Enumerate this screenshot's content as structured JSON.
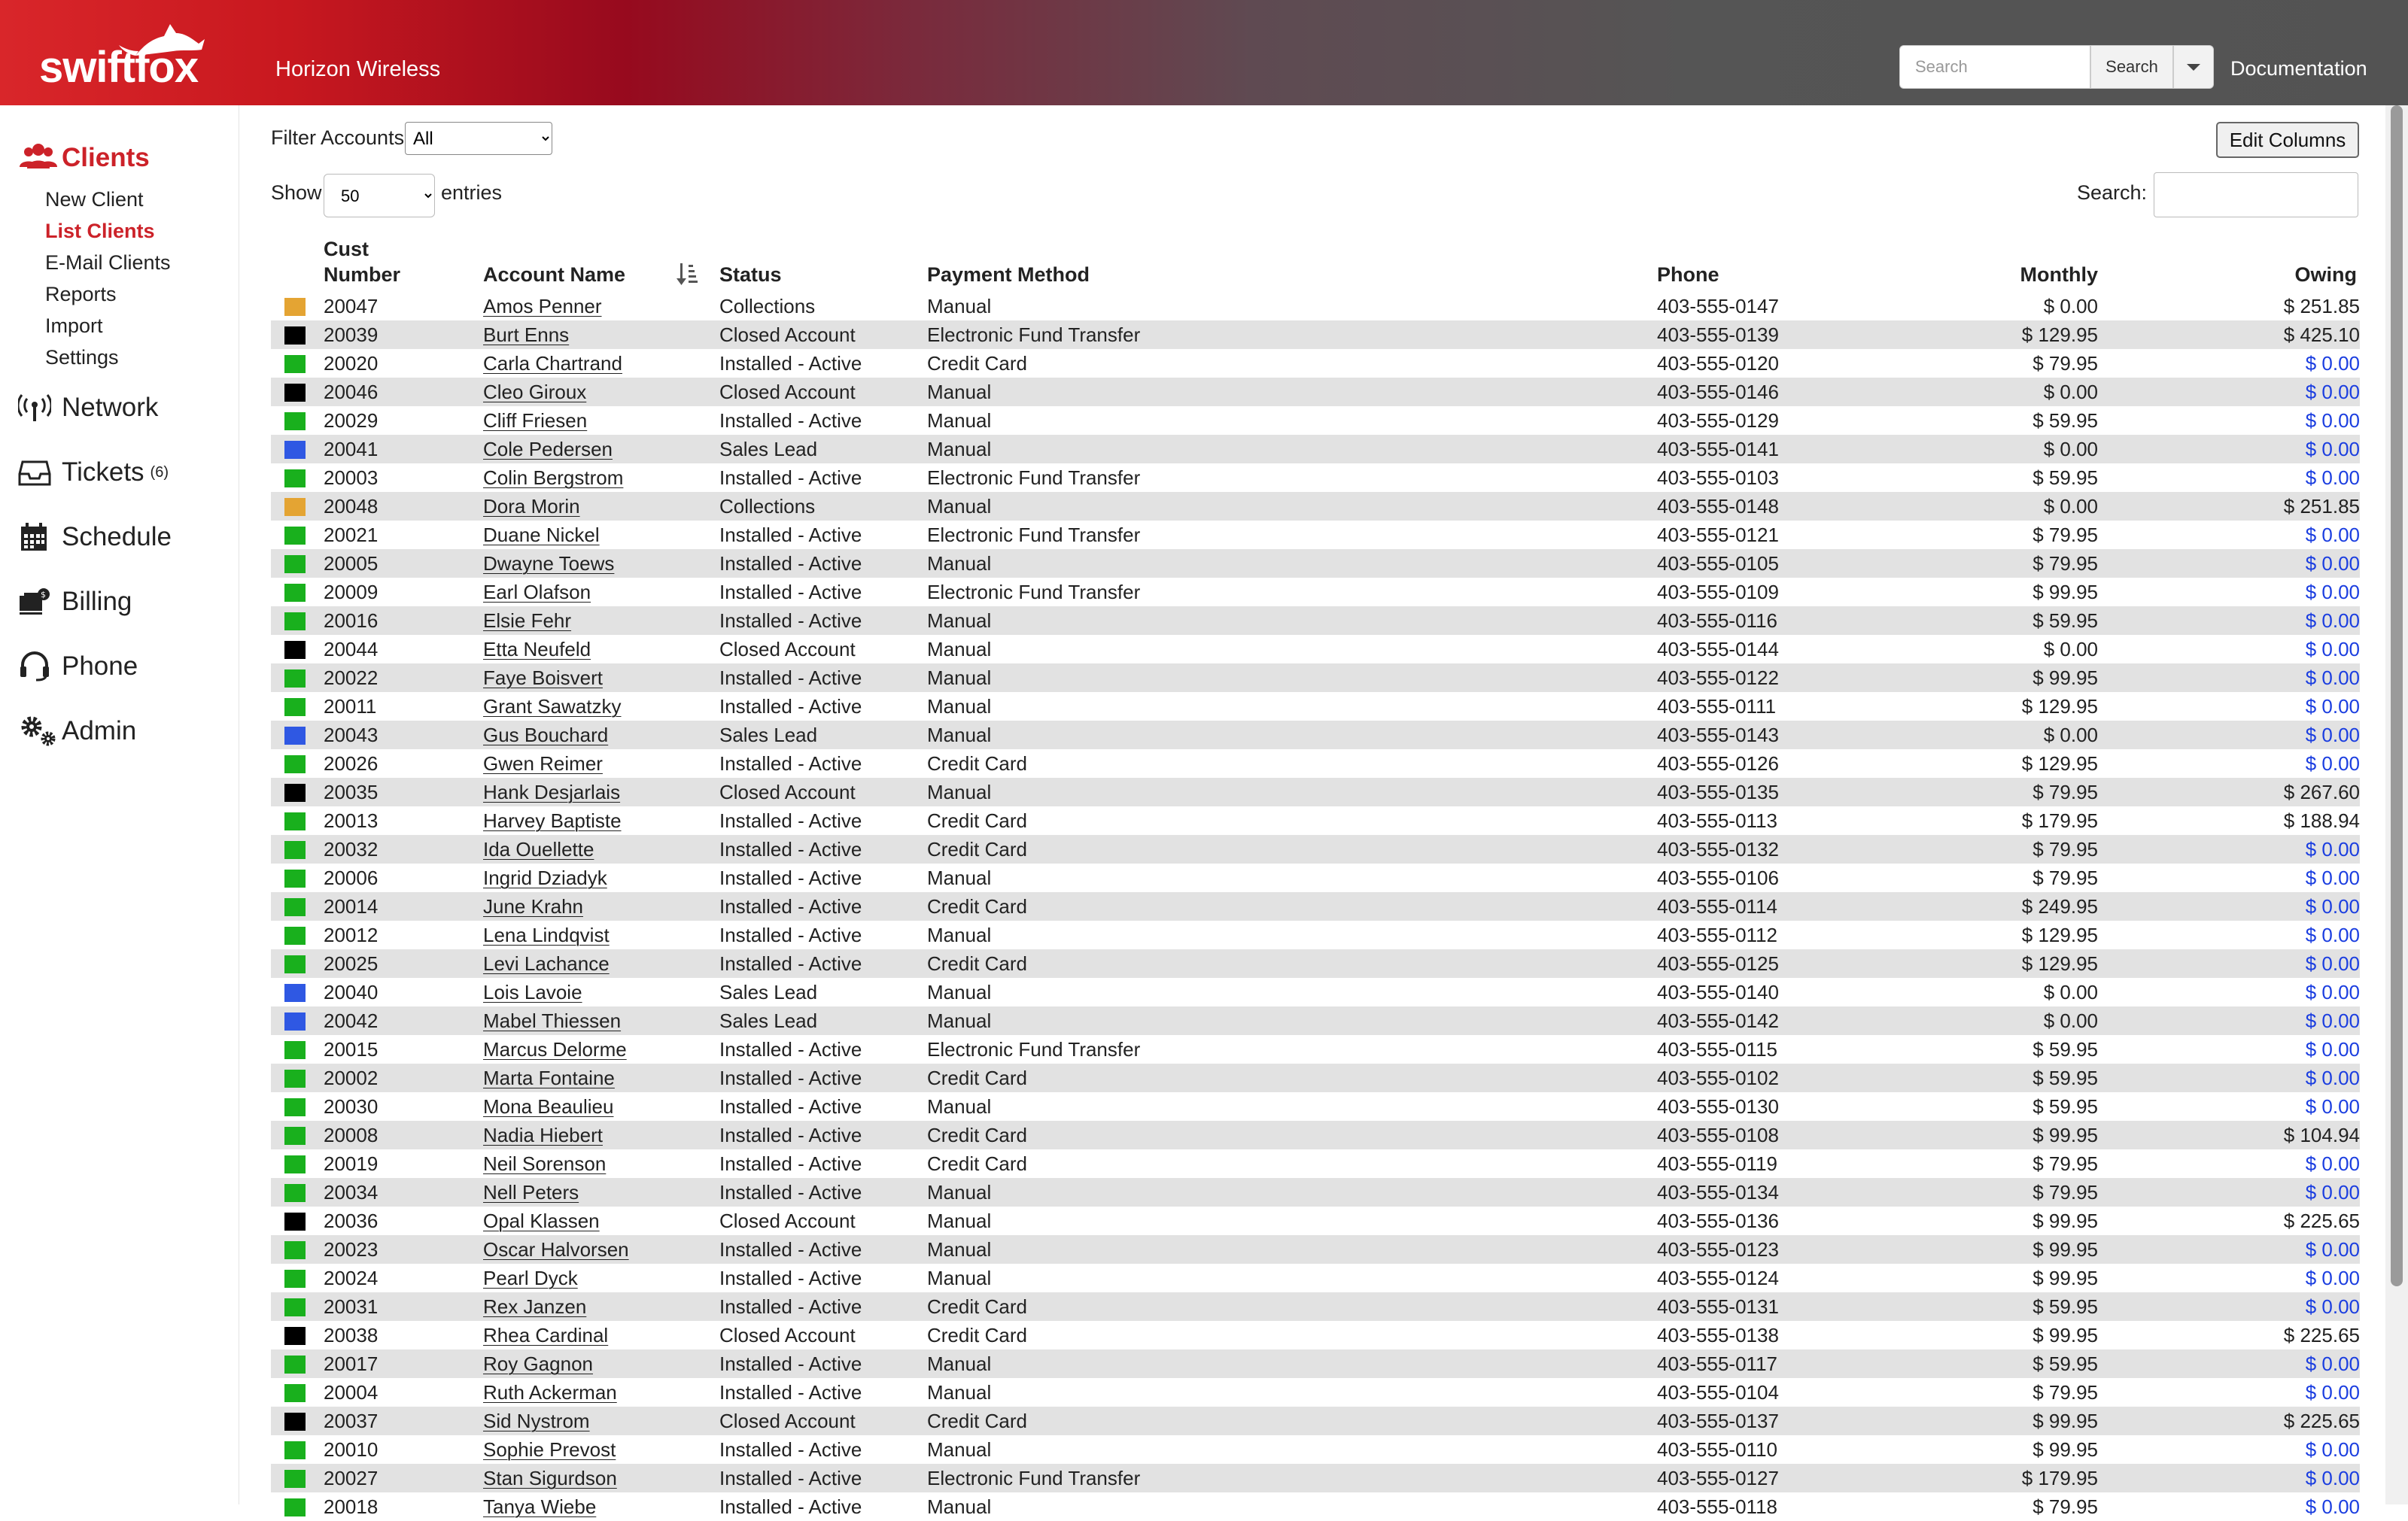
{
  "header": {
    "logo_text": "swiftfox",
    "brand": "Horizon Wireless",
    "search_placeholder": "Search",
    "search_button": "Search",
    "documentation": "Documentation"
  },
  "sidebar": {
    "clients": "Clients",
    "sub": [
      "New Client",
      "List Clients",
      "E-Mail Clients",
      "Reports",
      "Import",
      "Settings"
    ],
    "network": "Network",
    "tickets": "Tickets",
    "tickets_badge": "(6)",
    "schedule": "Schedule",
    "billing": "Billing",
    "phone": "Phone",
    "admin": "Admin"
  },
  "controls": {
    "filter_label": "Filter Accounts",
    "filter_value": "All",
    "show_label": "Show",
    "show_value": "50",
    "entries_label": "entries",
    "edit_columns": "Edit Columns",
    "search_label": "Search:"
  },
  "colors": {
    "Collections": "#e4a433",
    "Closed Account": "#000000",
    "Installed - Active": "#19b01d",
    "Sales Lead": "#2f58e3"
  },
  "table": {
    "headers": {
      "cust_number": "Cust Number",
      "account_name": "Account Name",
      "status": "Status",
      "payment_method": "Payment Method",
      "phone": "Phone",
      "monthly": "Monthly",
      "owing": "Owing"
    },
    "rows": [
      {
        "num": "20047",
        "name": "Amos Penner",
        "status": "Collections",
        "pay": "Manual",
        "phone": "403-555-0147",
        "monthly": "$ 0.00",
        "owing": "$ 251.85"
      },
      {
        "num": "20039",
        "name": "Burt Enns",
        "status": "Closed Account",
        "pay": "Electronic Fund Transfer",
        "phone": "403-555-0139",
        "monthly": "$ 129.95",
        "owing": "$ 425.10"
      },
      {
        "num": "20020",
        "name": "Carla Chartrand",
        "status": "Installed - Active",
        "pay": "Credit Card",
        "phone": "403-555-0120",
        "monthly": "$ 79.95",
        "owing": "$ 0.00"
      },
      {
        "num": "20046",
        "name": "Cleo Giroux",
        "status": "Closed Account",
        "pay": "Manual",
        "phone": "403-555-0146",
        "monthly": "$ 0.00",
        "owing": "$ 0.00"
      },
      {
        "num": "20029",
        "name": "Cliff Friesen",
        "status": "Installed - Active",
        "pay": "Manual",
        "phone": "403-555-0129",
        "monthly": "$ 59.95",
        "owing": "$ 0.00"
      },
      {
        "num": "20041",
        "name": "Cole Pedersen",
        "status": "Sales Lead",
        "pay": "Manual",
        "phone": "403-555-0141",
        "monthly": "$ 0.00",
        "owing": "$ 0.00"
      },
      {
        "num": "20003",
        "name": "Colin Bergstrom",
        "status": "Installed - Active",
        "pay": "Electronic Fund Transfer",
        "phone": "403-555-0103",
        "monthly": "$ 59.95",
        "owing": "$ 0.00"
      },
      {
        "num": "20048",
        "name": "Dora Morin",
        "status": "Collections",
        "pay": "Manual",
        "phone": "403-555-0148",
        "monthly": "$ 0.00",
        "owing": "$ 251.85"
      },
      {
        "num": "20021",
        "name": "Duane Nickel",
        "status": "Installed - Active",
        "pay": "Electronic Fund Transfer",
        "phone": "403-555-0121",
        "monthly": "$ 79.95",
        "owing": "$ 0.00"
      },
      {
        "num": "20005",
        "name": "Dwayne Toews",
        "status": "Installed - Active",
        "pay": "Manual",
        "phone": "403-555-0105",
        "monthly": "$ 79.95",
        "owing": "$ 0.00"
      },
      {
        "num": "20009",
        "name": "Earl Olafson",
        "status": "Installed - Active",
        "pay": "Electronic Fund Transfer",
        "phone": "403-555-0109",
        "monthly": "$ 99.95",
        "owing": "$ 0.00"
      },
      {
        "num": "20016",
        "name": "Elsie Fehr",
        "status": "Installed - Active",
        "pay": "Manual",
        "phone": "403-555-0116",
        "monthly": "$ 59.95",
        "owing": "$ 0.00"
      },
      {
        "num": "20044",
        "name": "Etta Neufeld",
        "status": "Closed Account",
        "pay": "Manual",
        "phone": "403-555-0144",
        "monthly": "$ 0.00",
        "owing": "$ 0.00"
      },
      {
        "num": "20022",
        "name": "Faye Boisvert",
        "status": "Installed - Active",
        "pay": "Manual",
        "phone": "403-555-0122",
        "monthly": "$ 99.95",
        "owing": "$ 0.00"
      },
      {
        "num": "20011",
        "name": "Grant Sawatzky",
        "status": "Installed - Active",
        "pay": "Manual",
        "phone": "403-555-0111",
        "monthly": "$ 129.95",
        "owing": "$ 0.00"
      },
      {
        "num": "20043",
        "name": "Gus Bouchard",
        "status": "Sales Lead",
        "pay": "Manual",
        "phone": "403-555-0143",
        "monthly": "$ 0.00",
        "owing": "$ 0.00"
      },
      {
        "num": "20026",
        "name": "Gwen Reimer",
        "status": "Installed - Active",
        "pay": "Credit Card",
        "phone": "403-555-0126",
        "monthly": "$ 129.95",
        "owing": "$ 0.00"
      },
      {
        "num": "20035",
        "name": "Hank Desjarlais",
        "status": "Closed Account",
        "pay": "Manual",
        "phone": "403-555-0135",
        "monthly": "$ 79.95",
        "owing": "$ 267.60"
      },
      {
        "num": "20013",
        "name": "Harvey Baptiste",
        "status": "Installed - Active",
        "pay": "Credit Card",
        "phone": "403-555-0113",
        "monthly": "$ 179.95",
        "owing": "$ 188.94"
      },
      {
        "num": "20032",
        "name": "Ida Ouellette",
        "status": "Installed - Active",
        "pay": "Credit Card",
        "phone": "403-555-0132",
        "monthly": "$ 79.95",
        "owing": "$ 0.00"
      },
      {
        "num": "20006",
        "name": "Ingrid Dziadyk",
        "status": "Installed - Active",
        "pay": "Manual",
        "phone": "403-555-0106",
        "monthly": "$ 79.95",
        "owing": "$ 0.00"
      },
      {
        "num": "20014",
        "name": "June Krahn",
        "status": "Installed - Active",
        "pay": "Credit Card",
        "phone": "403-555-0114",
        "monthly": "$ 249.95",
        "owing": "$ 0.00"
      },
      {
        "num": "20012",
        "name": "Lena Lindqvist",
        "status": "Installed - Active",
        "pay": "Manual",
        "phone": "403-555-0112",
        "monthly": "$ 129.95",
        "owing": "$ 0.00"
      },
      {
        "num": "20025",
        "name": "Levi Lachance",
        "status": "Installed - Active",
        "pay": "Credit Card",
        "phone": "403-555-0125",
        "monthly": "$ 129.95",
        "owing": "$ 0.00"
      },
      {
        "num": "20040",
        "name": "Lois Lavoie",
        "status": "Sales Lead",
        "pay": "Manual",
        "phone": "403-555-0140",
        "monthly": "$ 0.00",
        "owing": "$ 0.00"
      },
      {
        "num": "20042",
        "name": "Mabel Thiessen",
        "status": "Sales Lead",
        "pay": "Manual",
        "phone": "403-555-0142",
        "monthly": "$ 0.00",
        "owing": "$ 0.00"
      },
      {
        "num": "20015",
        "name": "Marcus Delorme",
        "status": "Installed - Active",
        "pay": "Electronic Fund Transfer",
        "phone": "403-555-0115",
        "monthly": "$ 59.95",
        "owing": "$ 0.00"
      },
      {
        "num": "20002",
        "name": "Marta Fontaine",
        "status": "Installed - Active",
        "pay": "Credit Card",
        "phone": "403-555-0102",
        "monthly": "$ 59.95",
        "owing": "$ 0.00"
      },
      {
        "num": "20030",
        "name": "Mona Beaulieu",
        "status": "Installed - Active",
        "pay": "Manual",
        "phone": "403-555-0130",
        "monthly": "$ 59.95",
        "owing": "$ 0.00"
      },
      {
        "num": "20008",
        "name": "Nadia Hiebert",
        "status": "Installed - Active",
        "pay": "Credit Card",
        "phone": "403-555-0108",
        "monthly": "$ 99.95",
        "owing": "$ 104.94"
      },
      {
        "num": "20019",
        "name": "Neil Sorenson",
        "status": "Installed - Active",
        "pay": "Credit Card",
        "phone": "403-555-0119",
        "monthly": "$ 79.95",
        "owing": "$ 0.00"
      },
      {
        "num": "20034",
        "name": "Nell Peters",
        "status": "Installed - Active",
        "pay": "Manual",
        "phone": "403-555-0134",
        "monthly": "$ 79.95",
        "owing": "$ 0.00"
      },
      {
        "num": "20036",
        "name": "Opal Klassen",
        "status": "Closed Account",
        "pay": "Manual",
        "phone": "403-555-0136",
        "monthly": "$ 99.95",
        "owing": "$ 225.65"
      },
      {
        "num": "20023",
        "name": "Oscar Halvorsen",
        "status": "Installed - Active",
        "pay": "Manual",
        "phone": "403-555-0123",
        "monthly": "$ 99.95",
        "owing": "$ 0.00"
      },
      {
        "num": "20024",
        "name": "Pearl Dyck",
        "status": "Installed - Active",
        "pay": "Manual",
        "phone": "403-555-0124",
        "monthly": "$ 99.95",
        "owing": "$ 0.00"
      },
      {
        "num": "20031",
        "name": "Rex Janzen",
        "status": "Installed - Active",
        "pay": "Credit Card",
        "phone": "403-555-0131",
        "monthly": "$ 59.95",
        "owing": "$ 0.00"
      },
      {
        "num": "20038",
        "name": "Rhea Cardinal",
        "status": "Closed Account",
        "pay": "Credit Card",
        "phone": "403-555-0138",
        "monthly": "$ 99.95",
        "owing": "$ 225.65"
      },
      {
        "num": "20017",
        "name": "Roy Gagnon",
        "status": "Installed - Active",
        "pay": "Manual",
        "phone": "403-555-0117",
        "monthly": "$ 59.95",
        "owing": "$ 0.00"
      },
      {
        "num": "20004",
        "name": "Ruth Ackerman",
        "status": "Installed - Active",
        "pay": "Manual",
        "phone": "403-555-0104",
        "monthly": "$ 79.95",
        "owing": "$ 0.00"
      },
      {
        "num": "20037",
        "name": "Sid Nystrom",
        "status": "Closed Account",
        "pay": "Credit Card",
        "phone": "403-555-0137",
        "monthly": "$ 99.95",
        "owing": "$ 225.65"
      },
      {
        "num": "20010",
        "name": "Sophie Prevost",
        "status": "Installed - Active",
        "pay": "Manual",
        "phone": "403-555-0110",
        "monthly": "$ 99.95",
        "owing": "$ 0.00"
      },
      {
        "num": "20027",
        "name": "Stan Sigurdson",
        "status": "Installed - Active",
        "pay": "Electronic Fund Transfer",
        "phone": "403-555-0127",
        "monthly": "$ 179.95",
        "owing": "$ 0.00"
      },
      {
        "num": "20018",
        "name": "Tanya Wiebe",
        "status": "Installed - Active",
        "pay": "Manual",
        "phone": "403-555-0118",
        "monthly": "$ 79.95",
        "owing": "$ 0.00"
      }
    ]
  }
}
